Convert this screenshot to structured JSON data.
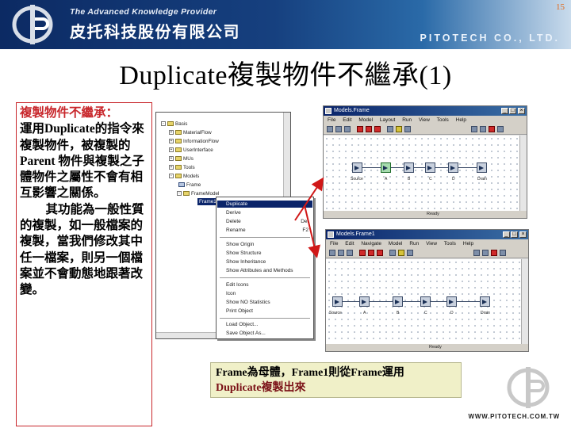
{
  "header": {
    "page_number": "15",
    "tagline": "The Advanced Knowledge Provider",
    "company_name_zh": "皮托科技股份有限公司",
    "company_name_en": "PITOTECH CO., LTD."
  },
  "slide": {
    "title": "Duplicate複製物件不繼承(1)",
    "text_heading": "複製物件不繼承：",
    "text_para1": "運用Duplicate的指令來複製物件，被複製的 Parent 物件與複製之子體物件之屬性不會有相互影響之關係。",
    "text_para2": "其功能為一般性質的複製，如一般檔案的複製，當我們修改其中任一檔案，則另一個檔案並不會動態地跟著改變。",
    "caption_line1": "Frame為母體，Frame1則從Frame運用",
    "caption_line2": "Duplicate複製出來"
  },
  "screenshot_top": {
    "window_title": "Models.Frame",
    "menu": [
      "File",
      "Edit",
      "Model",
      "Layout",
      "Run",
      "View",
      "Tools",
      "Help"
    ],
    "node_labels": [
      "Source",
      "A",
      "B",
      "C",
      "D",
      "Drain"
    ],
    "status": "Ready"
  },
  "screenshot_bottom": {
    "window_title": "Models.Frame1",
    "menu": [
      "File",
      "Edit",
      "Navigate",
      "Model",
      "Run",
      "View",
      "Tools",
      "Help"
    ],
    "node_labels": [
      "Source",
      "A",
      "B",
      "C",
      "D",
      "Drain"
    ],
    "status": "Ready"
  },
  "tree": {
    "items": [
      "Basis",
      "MaterialFlow",
      "InformationFlow",
      "UserInterface",
      "MUs",
      "Tools",
      "Models",
      "Frame",
      "FrameModel"
    ],
    "selected": "Frame1"
  },
  "context_menu": {
    "items": [
      "Duplicate",
      "Derive",
      "Delete",
      "Rename",
      "Show Origin",
      "Show Structure",
      "Show Inheritance",
      "Show Attributes and Methods",
      "Edit Icons",
      "Icon",
      "Show NO Statistics",
      "Print Object",
      "Load Object...",
      "Save Object As..."
    ],
    "shortcuts": {
      "Delete": "Del",
      "Rename": "F2"
    }
  },
  "footer": {
    "url": "WWW.PITOTECH.COM.TW"
  },
  "colors": {
    "accent_red": "#c8272c",
    "banner_navy": "#0c2a63",
    "caption_bg": "#f0f0c8"
  }
}
